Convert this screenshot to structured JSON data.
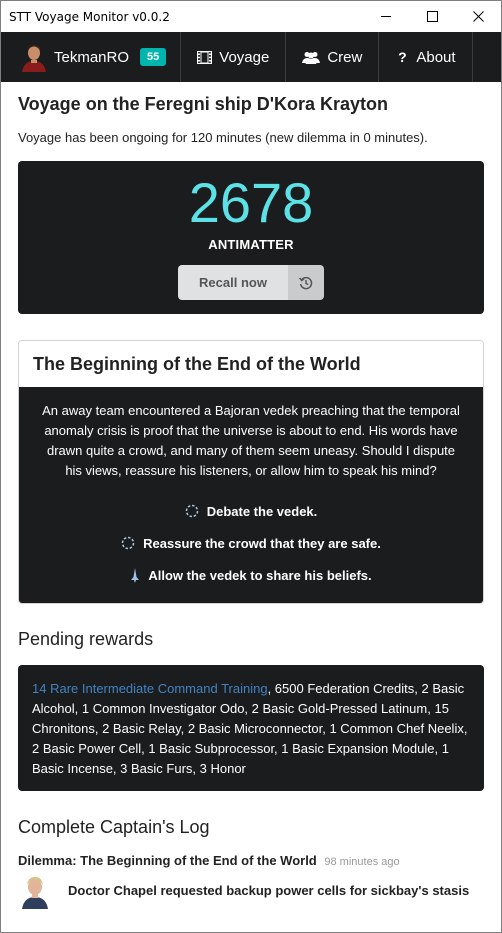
{
  "window": {
    "title": "STT Voyage Monitor v0.0.2"
  },
  "navbar": {
    "username": "TekmanRO",
    "level": "55",
    "items": [
      {
        "label": "Voyage",
        "icon": "film-icon"
      },
      {
        "label": "Crew",
        "icon": "users-icon"
      },
      {
        "label": "About",
        "icon": "question-icon"
      }
    ]
  },
  "voyage": {
    "heading": "Voyage on the Feregni ship D'Kora Krayton",
    "status": "Voyage has been ongoing for 120 minutes (new dilemma in 0 minutes).",
    "antimatter_value": "2678",
    "antimatter_label": "ANTIMATTER",
    "recall_label": "Recall now",
    "recall_icon": "history-icon"
  },
  "dilemma": {
    "title": "The Beginning of the End of the World",
    "text": "An away team encountered a Bajoran vedek preaching that the temporal anomaly crisis is proof that the universe is about to end. His words have drawn quite a crowd, and many of them seem uneasy. Should I dispute his views, reassure his listeners, or allow him to speak his mind?",
    "choices": [
      {
        "label": "Debate the vedek.",
        "icon": "spinner-icon"
      },
      {
        "label": "Reassure the crowd that they are safe.",
        "icon": "spinner-icon"
      },
      {
        "label": "Allow the vedek to share his beliefs.",
        "icon": "ship-icon"
      }
    ]
  },
  "rewards": {
    "heading": "Pending rewards",
    "highlight": "14 Rare Intermediate Command Training",
    "rest": ", 6500 Federation Credits, 2 Basic Alcohol, 1 Common Investigator Odo, 2 Basic Gold-Pressed Latinum, 15 Chronitons, 2 Basic Relay, 2 Basic Microconnector, 1 Common Chef Neelix, 2 Basic Power Cell, 1 Basic Subprocessor, 1 Basic Expansion Module, 1 Basic Incense, 3 Basic Furs, 3 Honor"
  },
  "log": {
    "heading": "Complete Captain's Log",
    "dilemma_title": "Dilemma: The Beginning of the End of the World",
    "dilemma_time": "98 minutes ago",
    "entry_text": "Doctor Chapel requested backup power cells for sickbay's stasis"
  },
  "colors": {
    "dark_bg": "#1b1c1d",
    "antimatter": "#5ce1e6",
    "badge": "#00b5ad",
    "link": "#4183c4"
  }
}
